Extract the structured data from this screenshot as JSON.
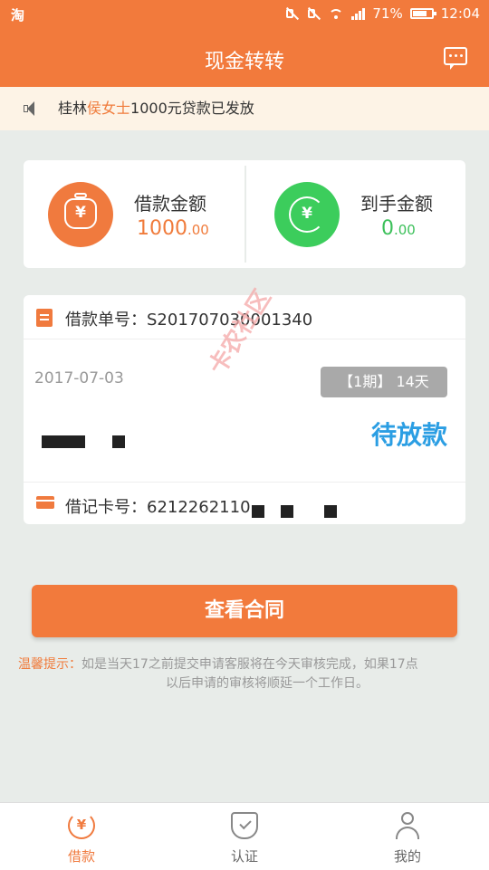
{
  "status_bar": {
    "app_icon": "淘",
    "battery": "71%",
    "time": "12:04"
  },
  "header": {
    "title": "现金转转",
    "message_icon": "message-icon"
  },
  "notice": {
    "prefix": "桂林",
    "highlight": "侯女士",
    "suffix": "1000元贷款已发放"
  },
  "amounts": {
    "loan": {
      "label": "借款金额",
      "int": "1000",
      "dec": ".00",
      "color": "#f07b3b"
    },
    "received": {
      "label": "到手金额",
      "int": "0",
      "dec": ".00",
      "color": "#3cc05a"
    }
  },
  "loan": {
    "no_label": "借款单号：",
    "no_value": "S201707030001340",
    "date": "2017-07-03",
    "period": "【1期】 14天",
    "status": "待放款",
    "card_label": "借记卡号：",
    "card_value": "6212262110"
  },
  "watermark": "卡农社区",
  "button": {
    "label": "查看合同"
  },
  "tip": {
    "label": "温馨提示：",
    "line1": "如是当天17之前提交申请客服将在今天审核完成，如果17点",
    "line2": "以后申请的审核将顺延一个工作日。"
  },
  "nav": [
    {
      "label": "借款",
      "active": true
    },
    {
      "label": "认证",
      "active": false
    },
    {
      "label": "我的",
      "active": false
    }
  ],
  "colors": {
    "primary": "#f27a3c",
    "status_blue": "#2b9ee3",
    "green": "#3ccd5c"
  }
}
